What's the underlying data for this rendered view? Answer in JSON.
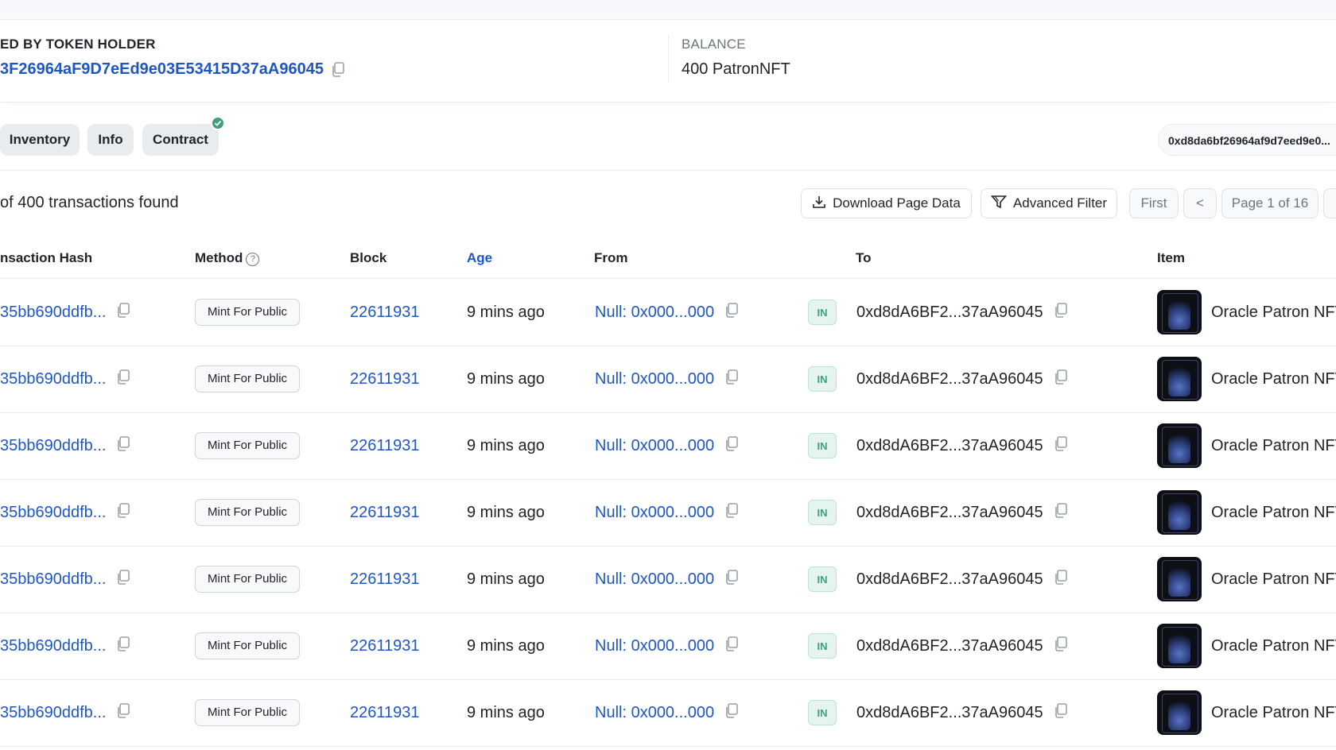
{
  "holder": {
    "label": "ED BY TOKEN HOLDER",
    "address": "3F26964aF9D7eEd9e03E53415D37aA96045",
    "balance_label": "BALANCE",
    "balance_value": "400 PatronNFT"
  },
  "tabs": [
    {
      "label": "Inventory"
    },
    {
      "label": "Info"
    },
    {
      "label": "Contract"
    }
  ],
  "contract_verified": true,
  "search_address": "0xd8da6bf26964af9d7eed9e0...",
  "summary": {
    "count_text": "of 400 transactions found"
  },
  "toolbar": {
    "download": "Download Page Data",
    "filter": "Advanced Filter",
    "first": "First",
    "prev": "<",
    "page": "Page 1 of 16"
  },
  "columns": {
    "hash": "nsaction Hash",
    "method": "Method",
    "block": "Block",
    "age": "Age",
    "from": "From",
    "to": "To",
    "item": "Item"
  },
  "rows": [
    {
      "hash": "35bb690ddfb...",
      "method": "Mint For Public",
      "block": "22611931",
      "age": "9 mins ago",
      "from": "Null: 0x000...000",
      "direction": "IN",
      "to": "0xd8dA6BF2...37aA96045",
      "item": "Oracle Patron NFT"
    },
    {
      "hash": "35bb690ddfb...",
      "method": "Mint For Public",
      "block": "22611931",
      "age": "9 mins ago",
      "from": "Null: 0x000...000",
      "direction": "IN",
      "to": "0xd8dA6BF2...37aA96045",
      "item": "Oracle Patron NFT"
    },
    {
      "hash": "35bb690ddfb...",
      "method": "Mint For Public",
      "block": "22611931",
      "age": "9 mins ago",
      "from": "Null: 0x000...000",
      "direction": "IN",
      "to": "0xd8dA6BF2...37aA96045",
      "item": "Oracle Patron NFT"
    },
    {
      "hash": "35bb690ddfb...",
      "method": "Mint For Public",
      "block": "22611931",
      "age": "9 mins ago",
      "from": "Null: 0x000...000",
      "direction": "IN",
      "to": "0xd8dA6BF2...37aA96045",
      "item": "Oracle Patron NFT"
    },
    {
      "hash": "35bb690ddfb...",
      "method": "Mint For Public",
      "block": "22611931",
      "age": "9 mins ago",
      "from": "Null: 0x000...000",
      "direction": "IN",
      "to": "0xd8dA6BF2...37aA96045",
      "item": "Oracle Patron NFT"
    },
    {
      "hash": "35bb690ddfb...",
      "method": "Mint For Public",
      "block": "22611931",
      "age": "9 mins ago",
      "from": "Null: 0x000...000",
      "direction": "IN",
      "to": "0xd8dA6BF2...37aA96045",
      "item": "Oracle Patron NFT"
    },
    {
      "hash": "35bb690ddfb...",
      "method": "Mint For Public",
      "block": "22611931",
      "age": "9 mins ago",
      "from": "Null: 0x000...000",
      "direction": "IN",
      "to": "0xd8dA6BF2...37aA96045",
      "item": "Oracle Patron NFT"
    }
  ],
  "colors": {
    "link": "#1e56c6",
    "verified": "#3f9f7f",
    "in_badge": "#3f9f7f"
  }
}
